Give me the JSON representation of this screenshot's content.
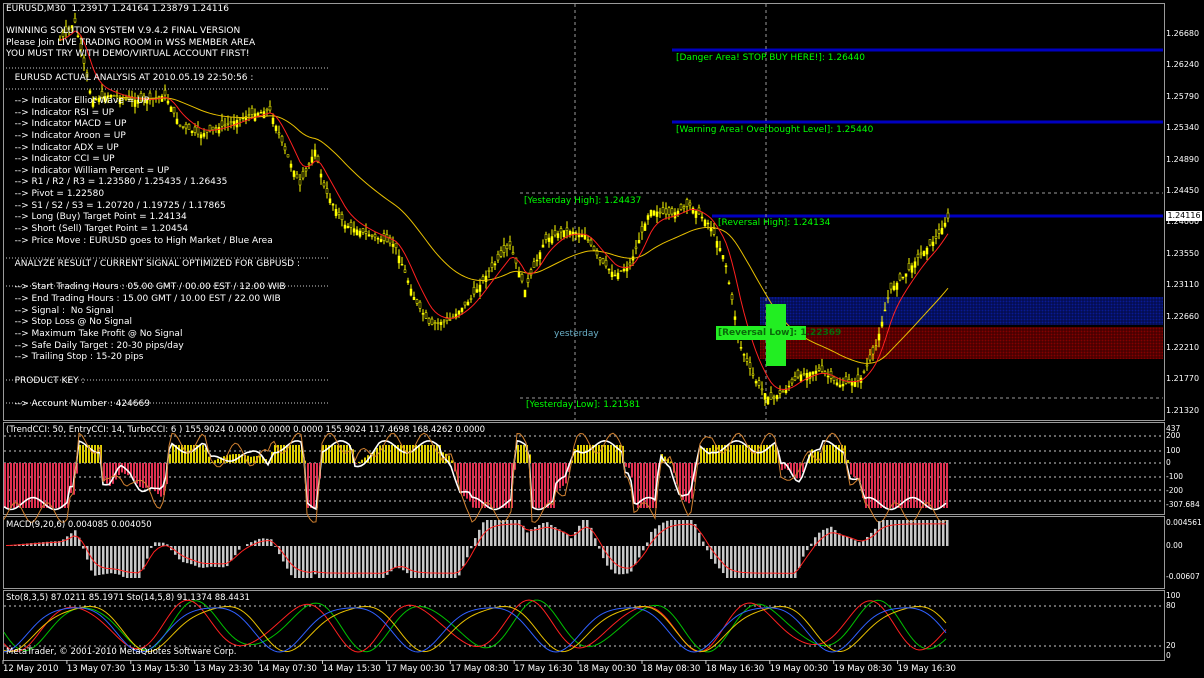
{
  "window": {
    "symbol_title": "EURUSD,M30  1.23917 1.24164 1.23879 1.24116"
  },
  "panel": {
    "lines": [
      "WINNING SOLUTION SYSTEM V.9.4.2 FINAL VERSION",
      "Please Join LIVE TRADING ROOM in WSS MEMBER AREA",
      "YOU MUST TRY WITH DEMO/VIRTUAL ACCOUNT FIRST!",
      "",
      "   EURUSD ACTUAL ANALYSIS AT 2010.05.19 22:50:56 :",
      "",
      "   --> Indicator Elliot Wave = UP",
      "   --> Indicator RSI = UP",
      "   --> Indicator MACD = UP",
      "   --> Indicator Aroon = UP",
      "   --> Indicator ADX = UP",
      "   --> Indicator CCI = UP",
      "   --> Indicator William Percent = UP",
      "   --> R1 / R2 / R3 = 1.23580 / 1.25435 / 1.26435",
      "   --> Pivot = 1.22580",
      "   --> S1 / S2 / S3 = 1.20720 / 1.19725 / 1.17865",
      "   --> Long (Buy) Target Point = 1.24134",
      "   --> Short (Sell) Target Point = 1.20454",
      "   --> Price Move : EURUSD goes to High Market / Blue Area",
      "",
      "   ANALYZE RESULT / CURRENT SIGNAL OPTIMIZED FOR GBPUSD :",
      "",
      "   --> Start Trading Hours : 05.00 GMT / 00.00 EST / 12.00 WIB",
      "   --> End Trading Hours : 15.00 GMT / 10.00 EST / 22.00 WIB",
      "   --> Signal :  No Signal",
      "   --> Stop Loss @ No Signal",
      "   --> Maximum Take Profit @ No Signal",
      "   --> Safe Daily Target : 20-30 pips/day",
      "   --> Trailing Stop : 15-20 pips",
      "",
      "   PRODUCT KEY :",
      "",
      "   --> Account Number : 424669"
    ]
  },
  "labels": {
    "danger": "[Danger Area! STOP BUY HERE!]: 1.26440",
    "warning": "[Warning Area! Overbought Level]: 1.25440",
    "yesterday_high": "[Yesterday High]: 1.24437",
    "reversal_high": "[Reversal High]: 1.24134",
    "yesterday": "yesterday",
    "yesterday_low": "[Yesterday Low]: 1.21581",
    "reversal_low": "[Reversal Low]: 1.22369"
  },
  "price_axis": [
    "1.26680",
    "1.26240",
    "1.25790",
    "1.25340",
    "1.24890",
    "1.24450",
    "1.24000",
    "1.23550",
    "1.23110",
    "1.22660",
    "1.22210",
    "1.21770",
    "1.21320"
  ],
  "current_price": "1.24116",
  "time_axis": [
    "12 May 2010",
    "13 May 07:30",
    "13 May 15:30",
    "13 May 23:30",
    "14 May 07:30",
    "14 May 15:30",
    "17 May 00:30",
    "17 May 08:30",
    "17 May 16:30",
    "18 May 00:30",
    "18 May 08:30",
    "18 May 16:30",
    "19 May 00:30",
    "19 May 08:30",
    "19 May 16:30"
  ],
  "indicators": {
    "cci_title": "(TrendCCI: 50, EntryCCI: 14, TurboCCI: 6 )  155.9024 0.0000 0.0000 0.0000 155.9024 117.4698 168.4262 0.0000",
    "cci_axis": [
      "437",
      "200",
      "100",
      "0",
      "-100",
      "-200",
      "-307.684"
    ],
    "macd_title": "MACD(9,20,6) 0.004085 0.004050",
    "macd_axis": [
      "0.004561",
      "0.00",
      "-0.00607"
    ],
    "sto_title": "Sto(8,3,5) 87.0211 85.1971  Sto(14,5,8) 91.1374 88.4431",
    "sto_axis": [
      "100",
      "80",
      "20",
      "0"
    ]
  },
  "footer": {
    "copyright": "MetaTrader, © 2001-2010 MetaQuotes Software Corp."
  },
  "colors": {
    "background": "#000000",
    "bull_candle": "#ffff00",
    "level_blue": "#0000b8",
    "blue_zone": "#0a1a9a",
    "red_zone": "#9a0000",
    "label_green": "#00ff00",
    "ma_red": "#ff2020",
    "ma_yellow": "#e8c000"
  }
}
